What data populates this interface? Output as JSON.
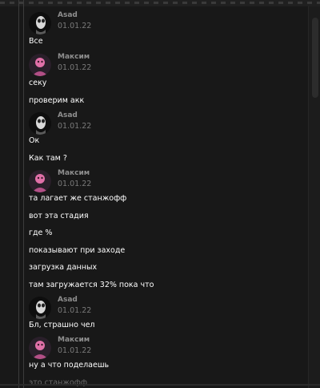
{
  "chat": {
    "messages": [
      {
        "author": "Asad",
        "date": "01.01.22",
        "avatar": "asad",
        "lines": [
          "Все"
        ]
      },
      {
        "author": "Максим",
        "date": "01.01.22",
        "avatar": "maxim",
        "lines": [
          "секу",
          "проверим акк"
        ]
      },
      {
        "author": "Asad",
        "date": "01.01.22",
        "avatar": "asad",
        "lines": [
          "Ок",
          "Как там ?"
        ]
      },
      {
        "author": "Максим",
        "date": "01.01.22",
        "avatar": "maxim",
        "lines": [
          "та лагает же станжофф",
          "вот эта стадия",
          "где %",
          "показывают при заходе",
          "загрузка данных",
          "там загружается 32% пока что"
        ]
      },
      {
        "author": "Asad",
        "date": "01.01.22",
        "avatar": "asad",
        "lines": [
          "Бл, страшно чел"
        ]
      },
      {
        "author": "Максим",
        "date": "01.01.22",
        "avatar": "maxim",
        "lines": [
          "ну а что поделаешь",
          "это станжофф"
        ]
      }
    ]
  }
}
